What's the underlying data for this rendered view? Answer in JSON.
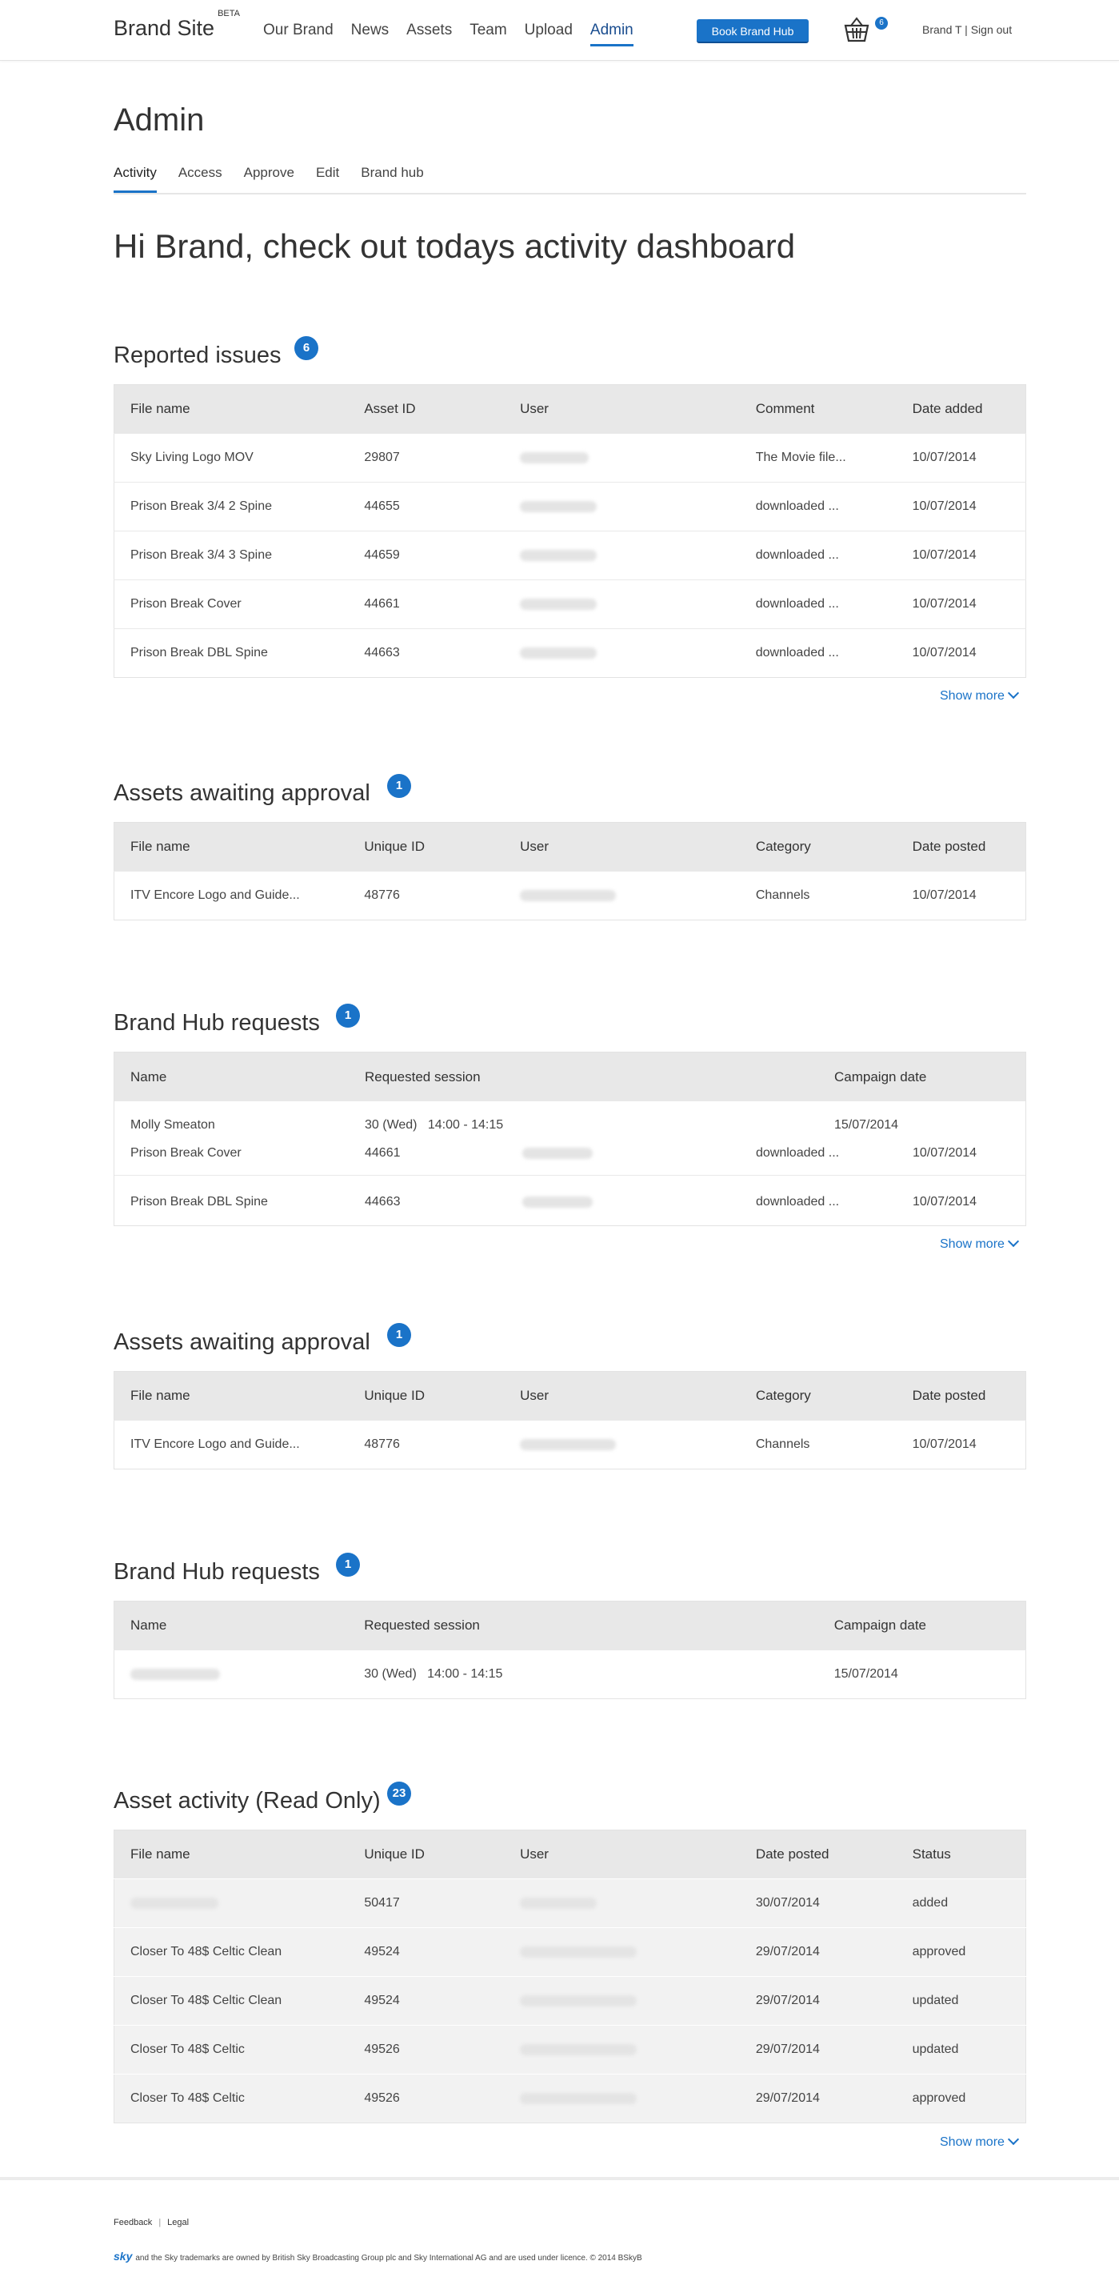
{
  "header": {
    "brand": "Brand Site",
    "brand_sup": "BETA",
    "nav": [
      "Our Brand",
      "News",
      "Assets",
      "Team",
      "Upload",
      "Admin"
    ],
    "book_button": "Book Brand Hub",
    "basket_count": "6",
    "user": "Brand T",
    "sign_out": "Sign out"
  },
  "page": {
    "title": "Admin",
    "tabs": [
      "Activity",
      "Access",
      "Approve",
      "Edit",
      "Brand hub"
    ],
    "greeting": "Hi Brand, check out todays activity dashboard"
  },
  "reported": {
    "title": "Reported issues",
    "count": "6",
    "columns": [
      "File name",
      "Asset ID",
      "User",
      "Comment",
      "Date added"
    ],
    "rows": [
      {
        "file": "Sky Living Logo MOV",
        "id": "29807",
        "comment": "The Movie file...",
        "date": "10/07/2014"
      },
      {
        "file": "Prison Break 3/4 2 Spine",
        "id": "44655",
        "comment": "downloaded ...",
        "date": "10/07/2014"
      },
      {
        "file": "Prison Break 3/4 3 Spine",
        "id": "44659",
        "comment": "downloaded ...",
        "date": "10/07/2014"
      },
      {
        "file": "Prison Break Cover",
        "id": "44661",
        "comment": "downloaded ...",
        "date": "10/07/2014"
      },
      {
        "file": "Prison Break DBL Spine",
        "id": "44663",
        "comment": "downloaded ...",
        "date": "10/07/2014"
      }
    ],
    "show_more": "Show more"
  },
  "awaiting1": {
    "title": "Assets awaiting approval",
    "count": "1",
    "columns": [
      "File name",
      "Unique ID",
      "User",
      "Category",
      "Date posted"
    ],
    "rows": [
      {
        "file": "ITV Encore Logo and Guide...",
        "id": "48776",
        "category": "Channels",
        "date": "10/07/2014"
      }
    ]
  },
  "hub1": {
    "title": "Brand Hub requests",
    "count": "1",
    "columns": [
      "Name",
      "Requested session",
      "Campaign date"
    ],
    "request": {
      "name": "Molly Smeaton",
      "session": "30 (Wed)   14:00 - 14:15",
      "date": "15/07/2014"
    },
    "extra_rows": [
      {
        "file": "Prison Break Cover",
        "id": "44661",
        "comment": "downloaded ...",
        "date": "10/07/2014"
      },
      {
        "file": "Prison Break DBL Spine",
        "id": "44663",
        "comment": "downloaded ...",
        "date": "10/07/2014"
      }
    ],
    "show_more": "Show more"
  },
  "awaiting2": {
    "title": "Assets awaiting approval",
    "count": "1",
    "columns": [
      "File name",
      "Unique ID",
      "User",
      "Category",
      "Date posted"
    ],
    "rows": [
      {
        "file": "ITV Encore Logo and Guide...",
        "id": "48776",
        "category": "Channels",
        "date": "10/07/2014"
      }
    ]
  },
  "hub2": {
    "title": "Brand Hub requests",
    "count": "1",
    "columns": [
      "Name",
      "Requested session",
      "Campaign date"
    ],
    "rows": [
      {
        "session": "30 (Wed)   14:00 - 14:15",
        "date": "15/07/2014"
      }
    ]
  },
  "activity": {
    "title": "Asset activity (Read Only)",
    "count": "23",
    "columns": [
      "File name",
      "Unique ID",
      "User",
      "Date posted",
      "Status"
    ],
    "rows": [
      {
        "file": "",
        "id": "50417",
        "date": "30/07/2014",
        "status": "added"
      },
      {
        "file": "Closer To 48$ Celtic Clean",
        "id": "49524",
        "date": "29/07/2014",
        "status": "approved"
      },
      {
        "file": "Closer To 48$ Celtic Clean",
        "id": "49524",
        "date": "29/07/2014",
        "status": "updated"
      },
      {
        "file": "Closer To 48$ Celtic",
        "id": "49526",
        "date": "29/07/2014",
        "status": "updated"
      },
      {
        "file": "Closer To 48$ Celtic",
        "id": "49526",
        "date": "29/07/2014",
        "status": "approved"
      }
    ],
    "show_more": "Show more"
  },
  "footer": {
    "feedback": "Feedback",
    "legal": "Legal",
    "sky": "sky",
    "legal_text": "and the Sky trademarks are owned by British Sky Broadcasting Group plc and Sky International AG and are used under licence. © 2014 BSkyB"
  },
  "colors": {
    "accent": "#1a73c8",
    "header_bg": "#e8e8e8",
    "readonly_row": "#f2f2f2"
  }
}
